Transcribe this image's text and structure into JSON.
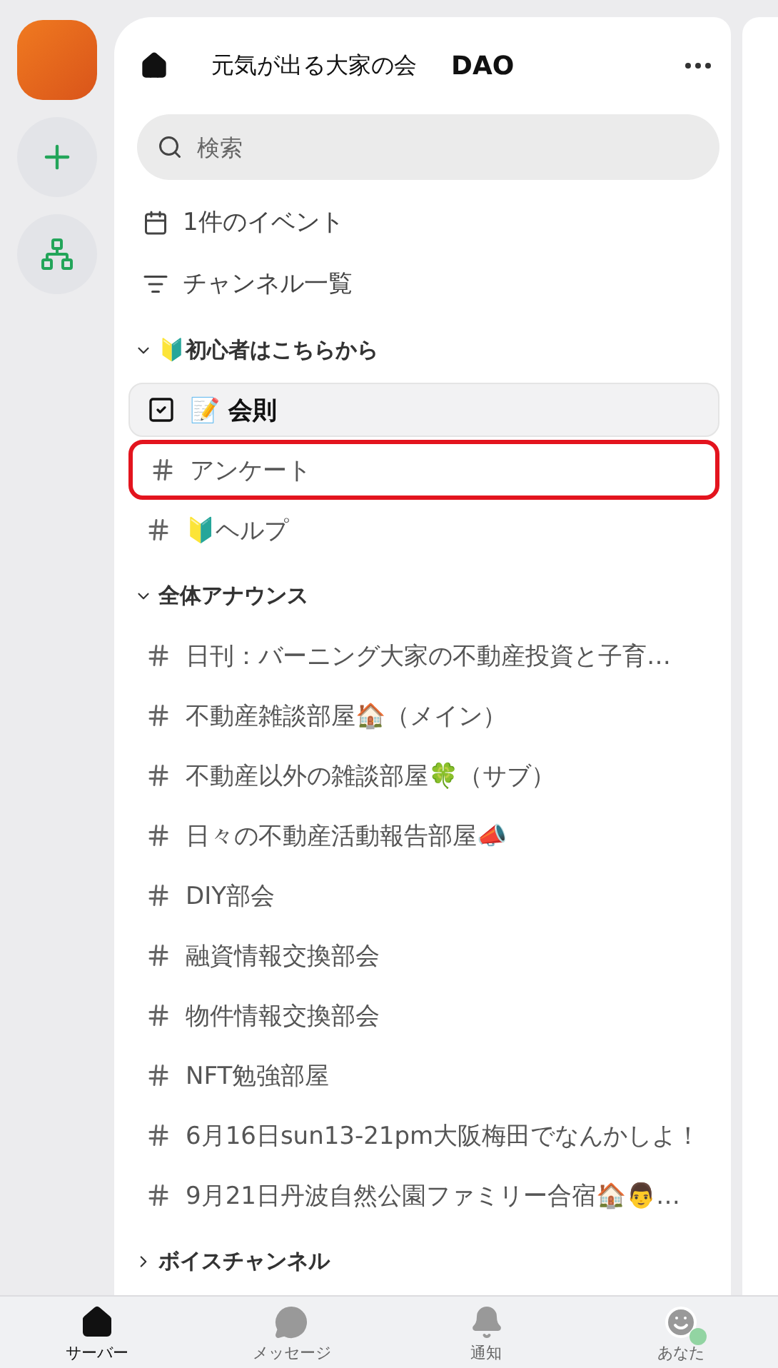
{
  "server": {
    "name": "元気が出る大家の会",
    "suffix": "DAO"
  },
  "search": {
    "placeholder": "検索"
  },
  "shortcuts": [
    {
      "kind": "events",
      "label": "1件のイベント"
    },
    {
      "kind": "channels",
      "label": "チャンネル一覧"
    }
  ],
  "categories": [
    {
      "name": "🔰初心者はこちらから",
      "expanded": true,
      "channels": [
        {
          "kind": "rules",
          "name": "📝 会則",
          "selected": true,
          "highlighted": false
        },
        {
          "kind": "text",
          "name": "アンケート",
          "selected": false,
          "highlighted": true
        },
        {
          "kind": "text",
          "name": "🔰ヘルプ",
          "selected": false,
          "highlighted": false
        }
      ]
    },
    {
      "name": "全体アナウンス",
      "expanded": true,
      "channels": [
        {
          "kind": "text",
          "name": "日刊：バーニング大家の不動産投資と子育…",
          "selected": false,
          "highlighted": false
        },
        {
          "kind": "text",
          "name": "不動産雑談部屋🏠（メイン）",
          "selected": false,
          "highlighted": false
        },
        {
          "kind": "text",
          "name": "不動産以外の雑談部屋🍀（サブ）",
          "selected": false,
          "highlighted": false
        },
        {
          "kind": "text",
          "name": "日々の不動産活動報告部屋📣",
          "selected": false,
          "highlighted": false
        },
        {
          "kind": "text",
          "name": "DIY部会",
          "selected": false,
          "highlighted": false
        },
        {
          "kind": "text",
          "name": "融資情報交換部会",
          "selected": false,
          "highlighted": false
        },
        {
          "kind": "text",
          "name": "物件情報交換部会",
          "selected": false,
          "highlighted": false
        },
        {
          "kind": "text",
          "name": "NFT勉強部屋",
          "selected": false,
          "highlighted": false
        },
        {
          "kind": "text",
          "name": "6月16日sun13-21pm大阪梅田でなんかしよ！",
          "selected": false,
          "highlighted": false
        },
        {
          "kind": "text",
          "name": "9月21日丹波自然公園ファミリー合宿🏠👨…",
          "selected": false,
          "highlighted": false
        }
      ]
    },
    {
      "name": "ボイスチャンネル",
      "expanded": false
    }
  ],
  "nav": [
    {
      "kind": "servers",
      "label": "サーバー",
      "selected": true
    },
    {
      "kind": "messages",
      "label": "メッセージ",
      "selected": false
    },
    {
      "kind": "notifications",
      "label": "通知",
      "selected": false
    },
    {
      "kind": "you",
      "label": "あなた",
      "selected": false
    }
  ]
}
